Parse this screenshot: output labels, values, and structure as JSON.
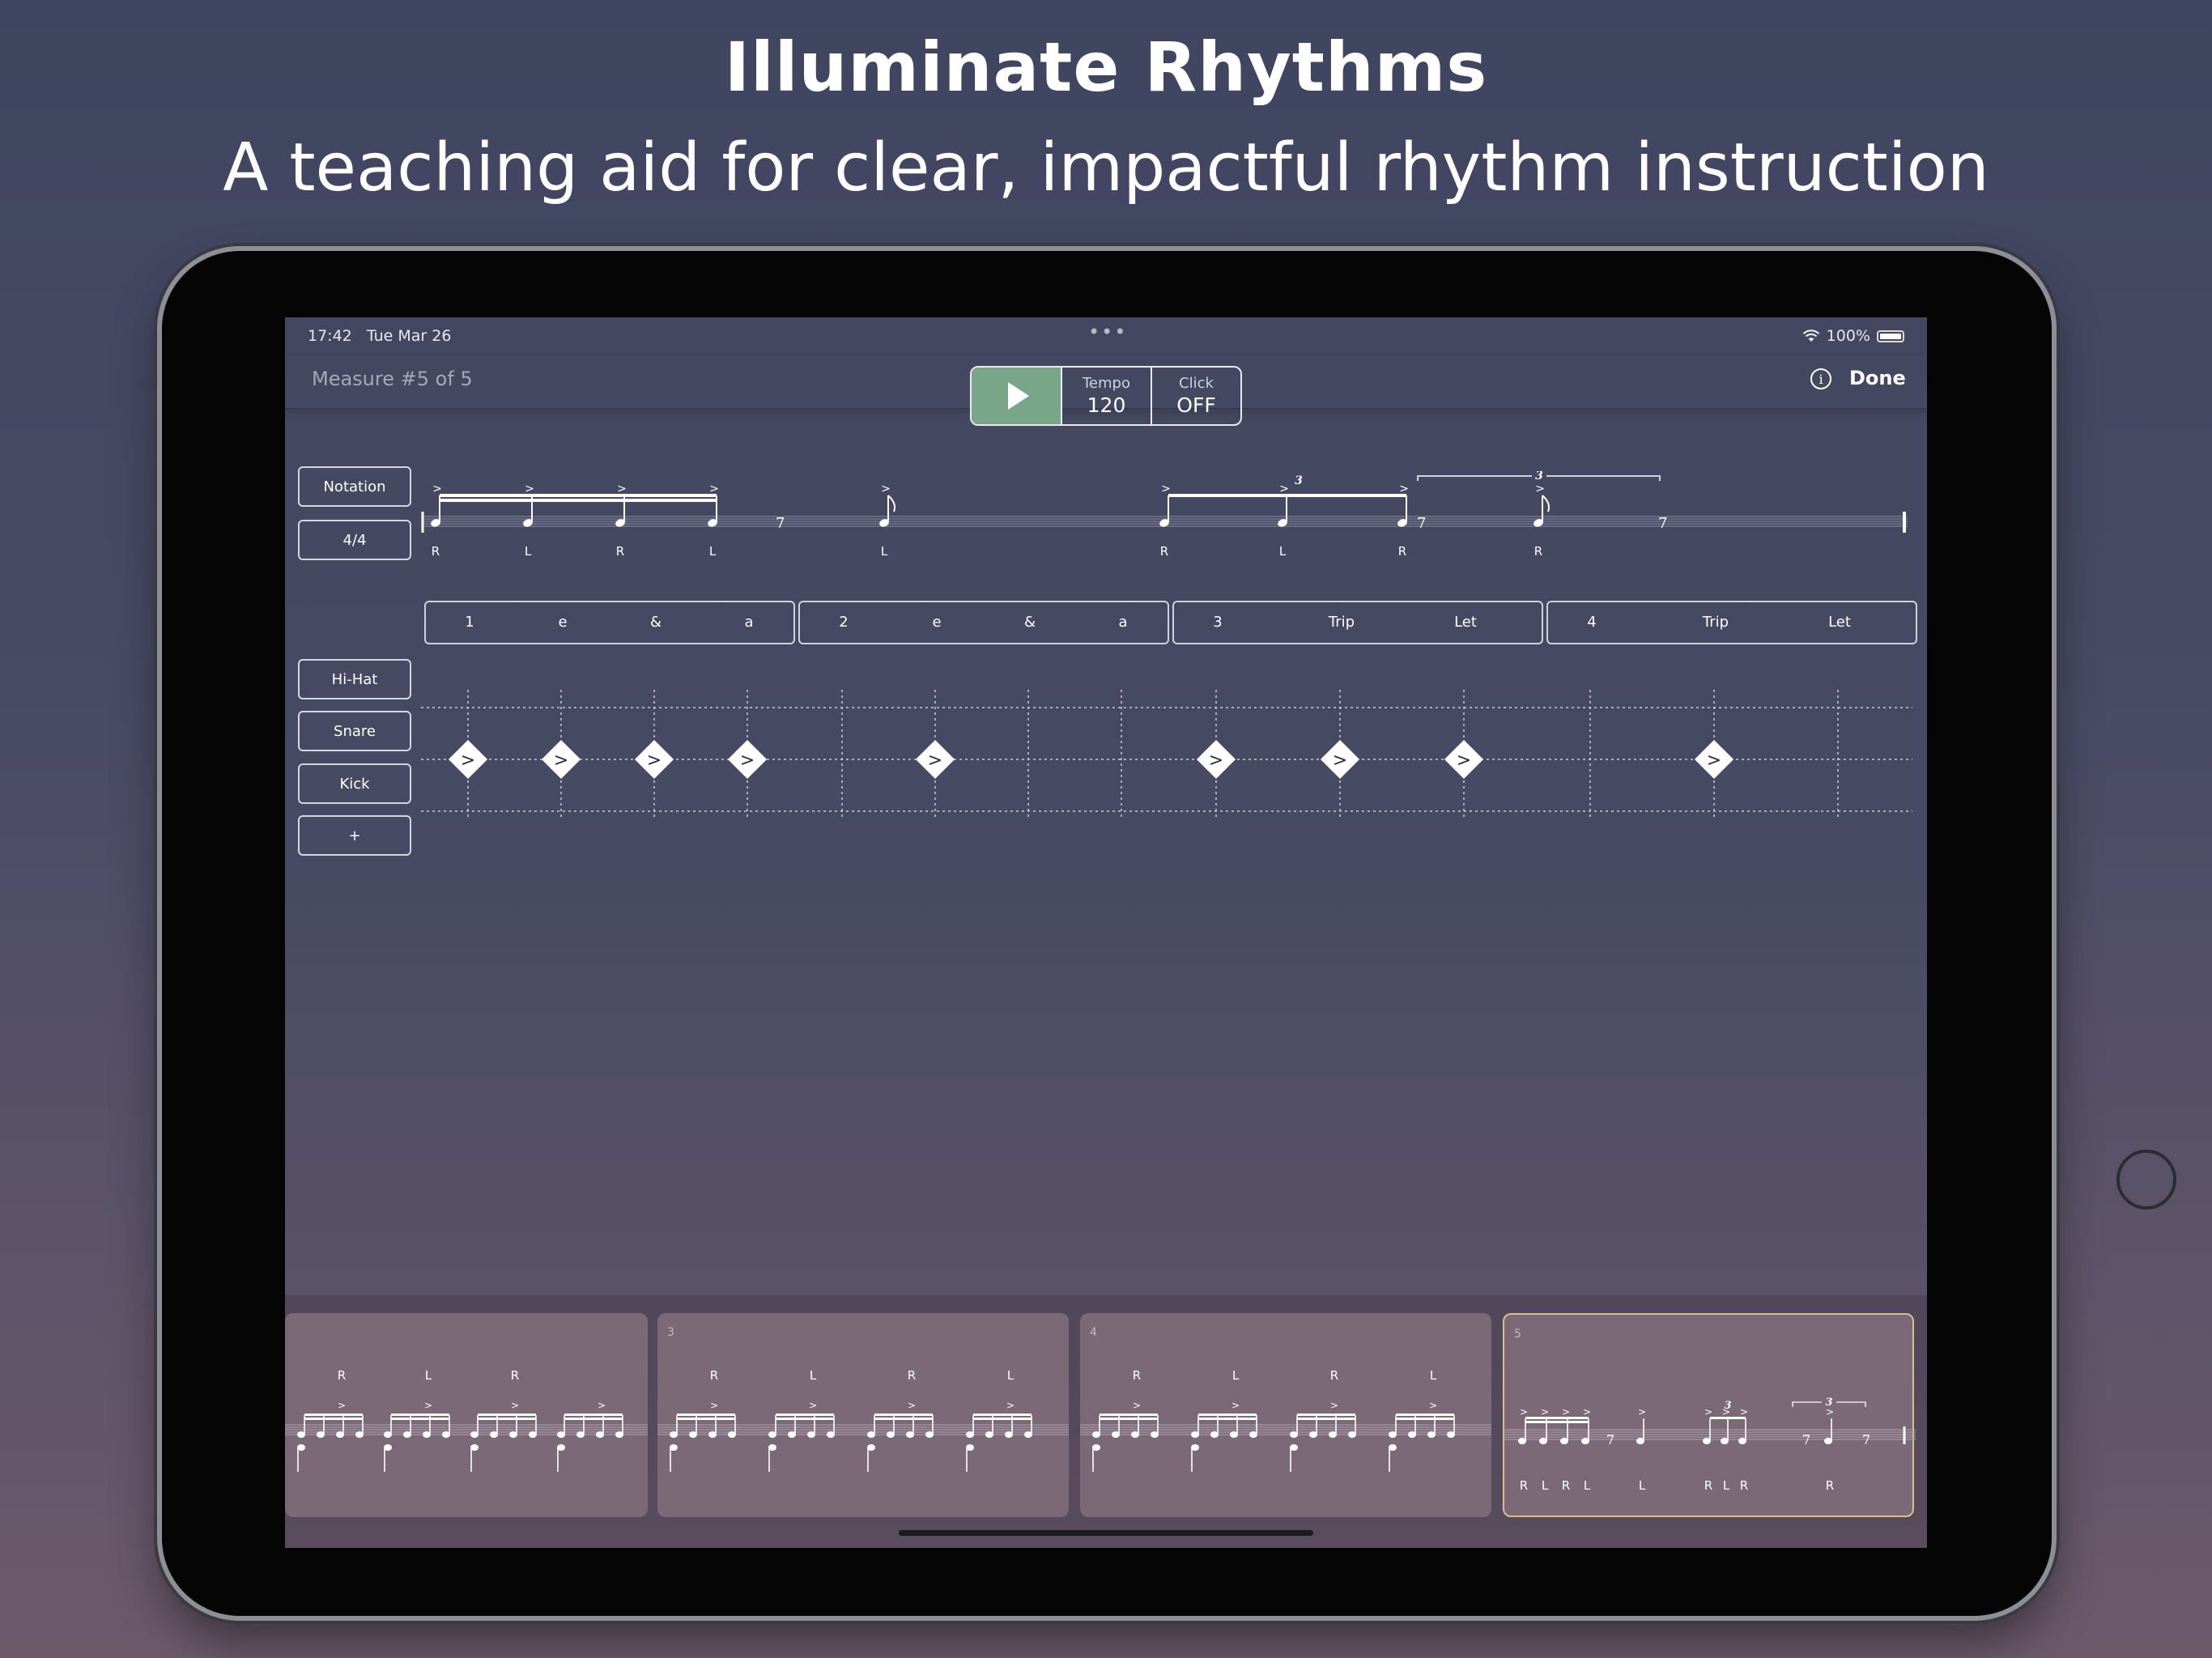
{
  "marketing": {
    "title": "Illuminate Rhythms",
    "subtitle": "A teaching aid for clear, impactful rhythm instruction"
  },
  "status_bar": {
    "time": "17:42",
    "date": "Tue Mar 26",
    "battery": "100%",
    "icons": [
      "wifi-icon",
      "battery-icon"
    ]
  },
  "nav": {
    "measure_label": "Measure #5 of 5",
    "tempo_label": "Tempo",
    "tempo_value": "120",
    "click_label": "Click",
    "click_value": "OFF",
    "done_label": "Done",
    "accent_color": "#79a589"
  },
  "side_buttons": {
    "notation": "Notation",
    "time_signature": "4/4",
    "hihat": "Hi-Hat",
    "snare": "Snare",
    "kick": "Kick",
    "add": "+"
  },
  "main_staff": {
    "sticking": [
      "R",
      "L",
      "R",
      "L",
      "L",
      "R",
      "L",
      "R",
      "R"
    ],
    "tuplets": [
      "3",
      "3"
    ]
  },
  "beats": [
    {
      "subdivisions": [
        "1",
        "e",
        "&",
        "a"
      ]
    },
    {
      "subdivisions": [
        "2",
        "e",
        "&",
        "a"
      ]
    },
    {
      "subdivisions": [
        "3",
        "Trip",
        "Let"
      ]
    },
    {
      "subdivisions": [
        "4",
        "Trip",
        "Let"
      ]
    }
  ],
  "snare_hits": [
    "1",
    "e",
    "&",
    "a",
    "e",
    "3",
    "Trip",
    "Let",
    "Trip"
  ],
  "accent_symbol": ">",
  "thumbnails": [
    {
      "number": "",
      "sticking": [
        "R",
        "L",
        "R"
      ]
    },
    {
      "number": "3",
      "sticking": [
        "R",
        "L",
        "R",
        "L"
      ]
    },
    {
      "number": "4",
      "sticking": [
        "R",
        "L",
        "R",
        "L"
      ]
    },
    {
      "number": "5",
      "sticking": [
        "R",
        "L",
        "R",
        "L",
        "L",
        "R",
        "L",
        "R",
        "R"
      ],
      "tuplets": [
        "3",
        "3"
      ],
      "selected": true
    }
  ],
  "selected_color": "#d9c087"
}
